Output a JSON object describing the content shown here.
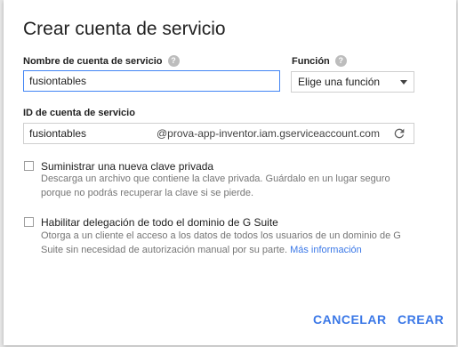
{
  "dialog": {
    "title": "Crear cuenta de servicio",
    "name_label": "Nombre de cuenta de servicio",
    "name_value": "fusiontables",
    "role_label": "Función",
    "role_value": "Elige una función",
    "id_label": "ID de cuenta de servicio",
    "id_value": "fusiontables",
    "id_suffix": "@prova-app-inventor.iam.gserviceaccount.com",
    "key_title": "Suministrar una nueva clave privada",
    "key_desc_1": "Descarga un archivo que contiene la clave privada. Guárdalo en un lugar seguro",
    "key_desc_2": "porque no podrás recuperar la clave si se pierde.",
    "gsuite_title": "Habilitar delegación de todo el dominio de G Suite",
    "gsuite_desc_1": "Otorga a un cliente el acceso a los datos de todos los usuarios de un dominio de G",
    "gsuite_desc_2": "Suite sin necesidad de autorización manual por su parte.",
    "gsuite_link": "Más información",
    "cancel_label": "CANCELAR",
    "create_label": "CREAR",
    "help_glyph": "?"
  },
  "colors": {
    "accent": "#3b78e7",
    "focus_border": "#4285f4",
    "help_icon": "#bdbdbd"
  },
  "icons": {
    "help": "help-icon",
    "dropdown": "chevron-down-icon",
    "refresh": "refresh-icon"
  }
}
